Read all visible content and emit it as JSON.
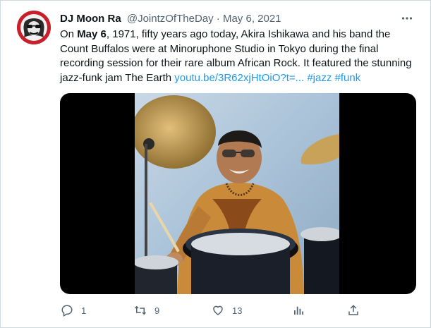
{
  "tweet": {
    "author_name": "DJ Moon Ra",
    "handle": "@JointzOfTheDay",
    "separator": "·",
    "date": "May 6, 2021",
    "text": {
      "t1": "On ",
      "t2_bold": "May 6",
      "t3": ", 1971, fifty years ago today, Akira Ishikawa and his band the Count Buffalos were at Minoruphone Studio in Tokyo during the final recording session for their rare album African Rock. It featured the stunning jazz-funk jam The Earth ",
      "link": "youtu.be/3R62xjHtOiO?t=...",
      "space": " ",
      "hashtag1": "#jazz",
      "hashtag2": "#funk"
    }
  },
  "actions": {
    "reply_count": "1",
    "retweet_count": "9",
    "like_count": "13",
    "views_count": "",
    "share_count": ""
  },
  "icons": {
    "more": "more-dots-icon",
    "reply": "reply-icon",
    "retweet": "retweet-icon",
    "like": "heart-icon",
    "views": "analytics-icon",
    "share": "share-icon"
  },
  "colors": {
    "link": "#1d9bf0",
    "secondary_text": "#536471",
    "avatar_bg": "#c8202a"
  }
}
